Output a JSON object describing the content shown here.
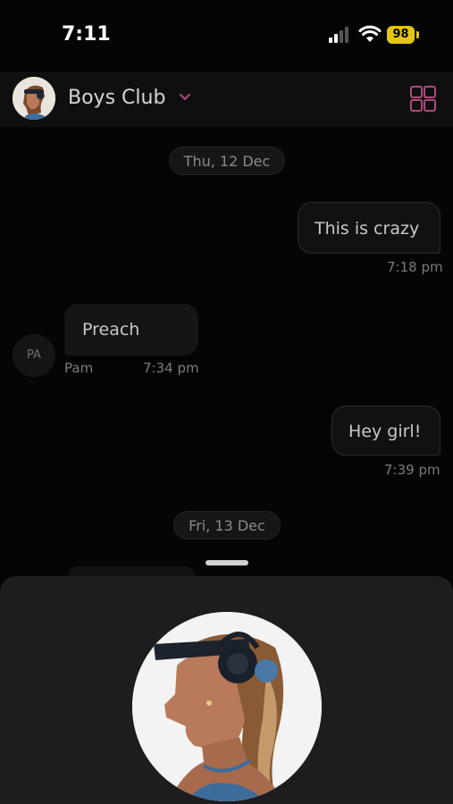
{
  "status_bar": {
    "time": "7:11",
    "battery": "98",
    "battery_color": "#e5c41a"
  },
  "header": {
    "title": "Boys Club",
    "accent_color": "#b04a7a",
    "avatar_icon": "woman-with-headphones-avatar",
    "menu_icon": "grid-icon",
    "chevron_icon": "chevron-down-icon"
  },
  "chat": {
    "date_1": "Thu, 12 Dec",
    "date_2": "Fri, 13 Dec",
    "messages": [
      {
        "direction": "out",
        "text": "This is crazy",
        "time": "7:18 pm"
      },
      {
        "direction": "in",
        "text": "Preach",
        "sender": "Pam",
        "initials": "PA",
        "time": "7:34 pm"
      },
      {
        "direction": "out",
        "text": "Hey girl!",
        "time": "7:39 pm"
      }
    ]
  },
  "sheet": {
    "profile_icon": "woman-with-headphones-illustration"
  }
}
